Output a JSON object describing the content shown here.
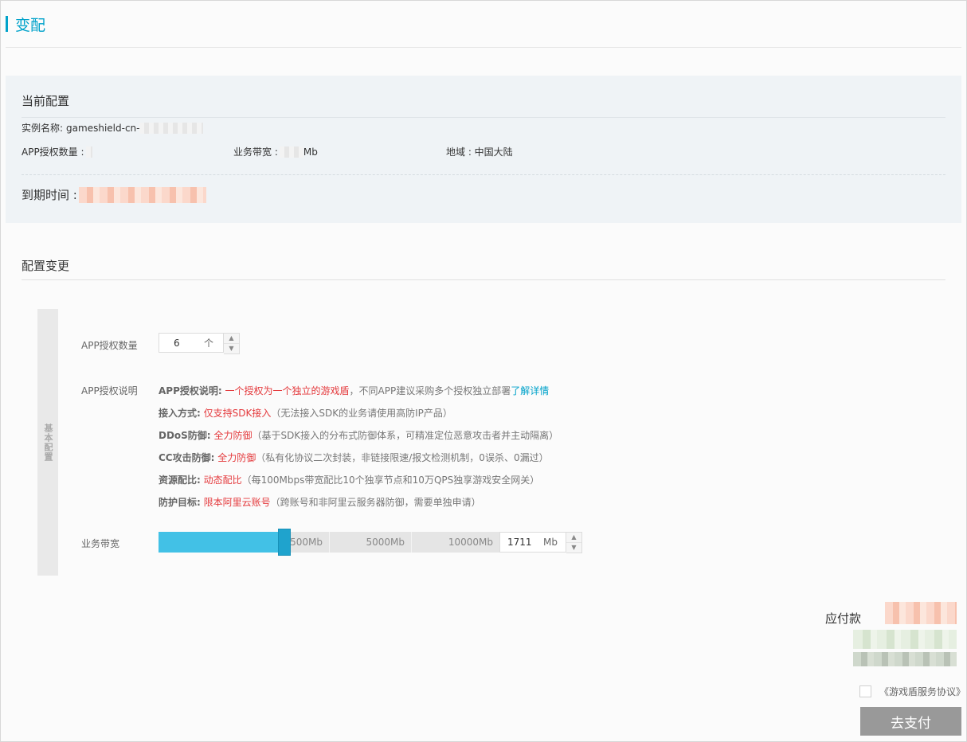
{
  "page": {
    "title": "变配"
  },
  "current_config": {
    "heading": "当前配置",
    "instance_label": "实例名称:",
    "instance_prefix": "gameshield-cn-",
    "app_count_label": "APP授权数量 :",
    "bandwidth_label": "业务带宽 :",
    "bandwidth_unit": "Mb",
    "region_label": "地域 : 中国大陆",
    "expire_label": "到期时间 :"
  },
  "change_config": {
    "heading": "配置变更",
    "side_tab": "基本配置",
    "app_count": {
      "label": "APP授权数量",
      "value": "6",
      "unit": "个"
    },
    "app_desc": {
      "label": "APP授权说明",
      "lines": [
        {
          "key": "APP授权说明:",
          "highlight": "一个授权为一个独立的游戏盾",
          "note": "，不同APP建议采购多个授权独立部署",
          "link": "了解详情"
        },
        {
          "key": "接入方式:",
          "highlight": "仅支持SDK接入",
          "note": "（无法接入SDK的业务请使用高防IP产品）"
        },
        {
          "key": "DDoS防御:",
          "highlight": "全力防御",
          "note": "（基于SDK接入的分布式防御体系，可精准定位恶意攻击者并主动隔离）"
        },
        {
          "key": "CC攻击防御:",
          "highlight": "全力防御",
          "note": "（私有化协议二次封装，非链接限速/报文检测机制，0误杀、0漏过）"
        },
        {
          "key": "资源配比:",
          "highlight": "动态配比",
          "note": "（每100Mbps带宽配比10个独享节点和10万QPS独享游戏安全网关）"
        },
        {
          "key": "防护目标:",
          "highlight": "限本阿里云账号",
          "note": "（跨账号和非阿里云服务器防御，需要单独申请）"
        }
      ]
    },
    "bandwidth": {
      "label": "业务带宽",
      "ticks": [
        "2500Mb",
        "5000Mb",
        "10000Mb"
      ],
      "value": "1711",
      "unit": "Mb",
      "slider_fill_fraction": 0.365
    }
  },
  "order": {
    "payable_label": "应付款",
    "agreement": "《游戏盾服务协议》",
    "pay_button": "去支付"
  },
  "colors": {
    "accent": "#00a2ca",
    "slider": "#42c1e6",
    "highlight": "#e4393c"
  },
  "icons": {
    "spin_up": "triangle-up-icon",
    "spin_down": "triangle-down-icon"
  }
}
